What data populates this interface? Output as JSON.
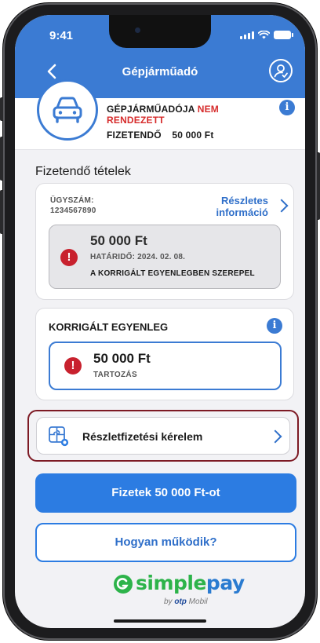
{
  "status_bar": {
    "time": "9:41"
  },
  "nav": {
    "title": "Gépjárműadó",
    "back_icon": "chevron-left-icon",
    "user_icon": "user-check-icon"
  },
  "summary": {
    "line1_prefix": "GÉPJÁRMŰADÓJA",
    "line1_status": "NEM",
    "line2_status": "RENDEZETT",
    "due_label": "FIZETENDŐ",
    "due_amount": "50 000 Ft",
    "vehicle_icon": "car-icon",
    "info_icon": "info-icon"
  },
  "section": {
    "title": "Fizetendő tételek"
  },
  "case": {
    "label": "ÜGYSZÁM:",
    "number": "1234567890",
    "details_line1": "Részletes",
    "details_line2": "információ",
    "item": {
      "amount": "50 000 Ft",
      "deadline": "HATÁRIDŐ: 2024. 02. 08.",
      "note": "A KORRIGÁLT EGYENLEGBEN SZEREPEL",
      "alert_icon": "exclamation-icon"
    }
  },
  "corrected": {
    "title": "KORRIGÁLT EGYENLEG",
    "amount": "50 000 Ft",
    "status": "TARTOZÁS",
    "alert_icon": "exclamation-icon"
  },
  "installment": {
    "label": "Részletfizetési kérelem",
    "icon": "installment-puzzle-icon"
  },
  "actions": {
    "pay_label": "Fizetek 50 000 Ft-ot",
    "how_label": "Hogyan működik?"
  },
  "brand": {
    "simple": "simple",
    "pay": "pay",
    "by": "by",
    "otp": "otp",
    "mobil": "Mobil"
  },
  "colors": {
    "primary": "#3b7bd3",
    "alert": "#c8212e",
    "warning_text": "#d62b2b",
    "highlight_border": "#7d1a24",
    "brand_green": "#2db34a"
  }
}
